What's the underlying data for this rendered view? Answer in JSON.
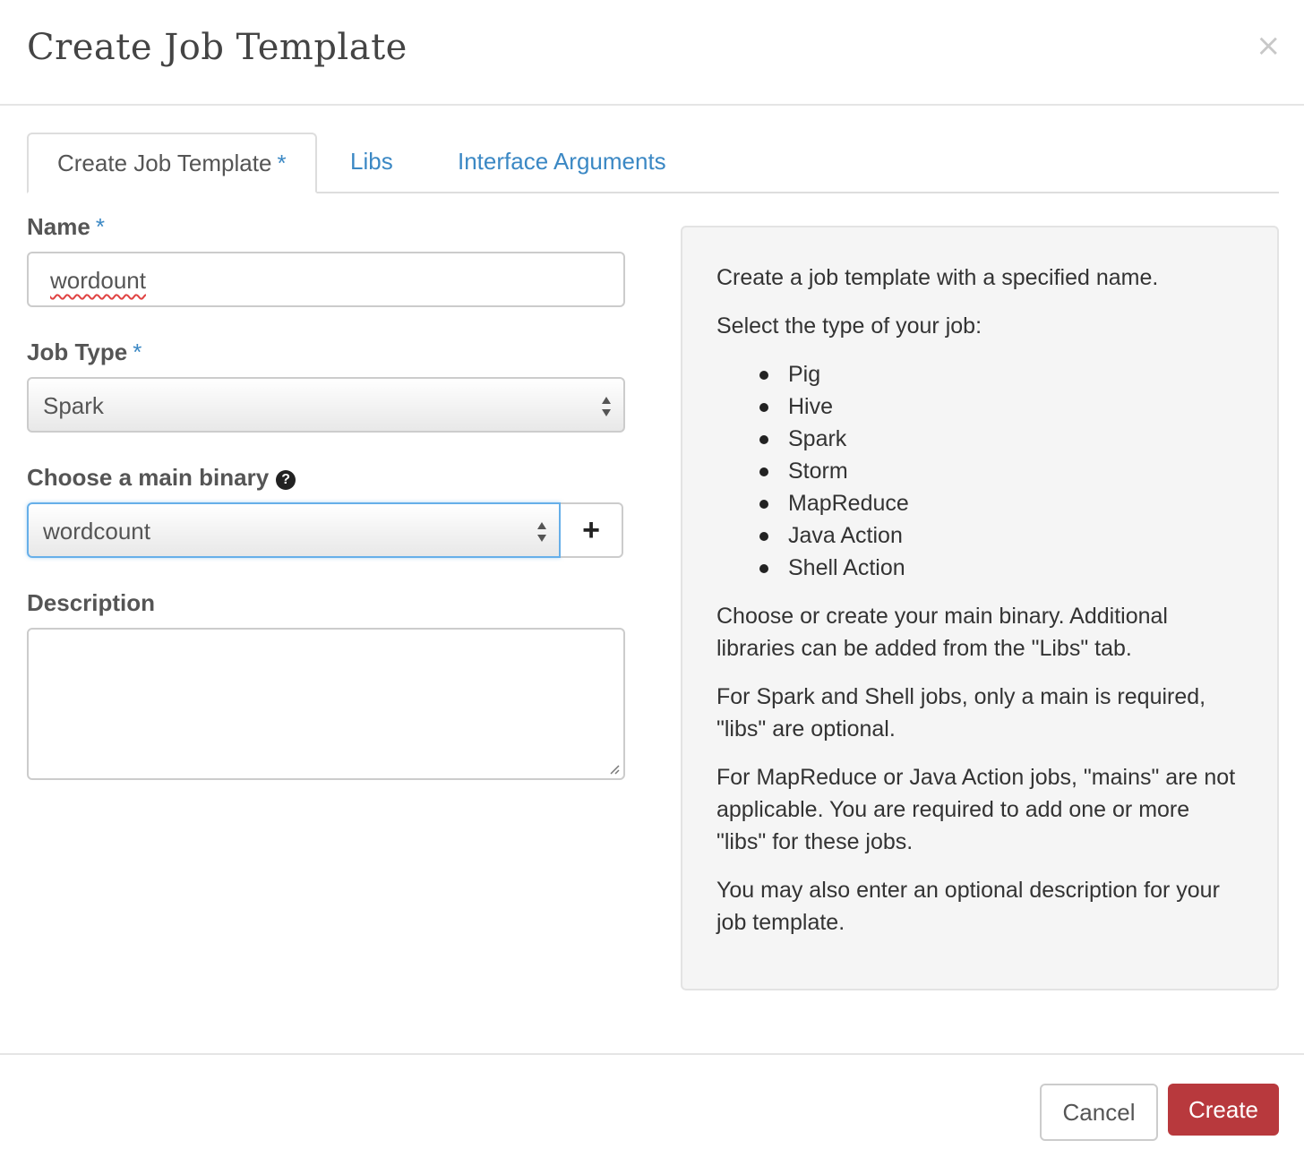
{
  "modal": {
    "title": "Create Job Template",
    "close_symbol": "×"
  },
  "tabs": [
    {
      "label": "Create Job Template",
      "required": "*",
      "active": true
    },
    {
      "label": "Libs"
    },
    {
      "label": "Interface Arguments"
    }
  ],
  "form": {
    "name": {
      "label": "Name",
      "required": "*",
      "value": "wordount"
    },
    "job_type": {
      "label": "Job Type",
      "required": "*",
      "selected": "Spark"
    },
    "main_binary": {
      "label": "Choose a main binary",
      "help_icon": "question-circle-icon",
      "selected": "wordcount",
      "add_symbol": "+"
    },
    "description": {
      "label": "Description",
      "value": ""
    }
  },
  "help": {
    "intro": "Create a job template with a specified name.",
    "type_prompt": "Select the type of your job:",
    "job_types": [
      "Pig",
      "Hive",
      "Spark",
      "Storm",
      "MapReduce",
      "Java Action",
      "Shell Action"
    ],
    "binary_note": "Choose or create your main binary. Additional libraries can be added from the \"Libs\" tab.",
    "spark_note": "For Spark and Shell jobs, only a main is required, \"libs\" are optional.",
    "mapreduce_note": "For MapReduce or Java Action jobs, \"mains\" are not applicable. You are required to add one or more \"libs\" for these jobs.",
    "description_note": "You may also enter an optional description for your job template."
  },
  "footer": {
    "cancel_label": "Cancel",
    "create_label": "Create"
  },
  "colors": {
    "accent_link": "#3b88c4",
    "primary_button": "#b8393d",
    "focus_border": "#66afe9"
  }
}
